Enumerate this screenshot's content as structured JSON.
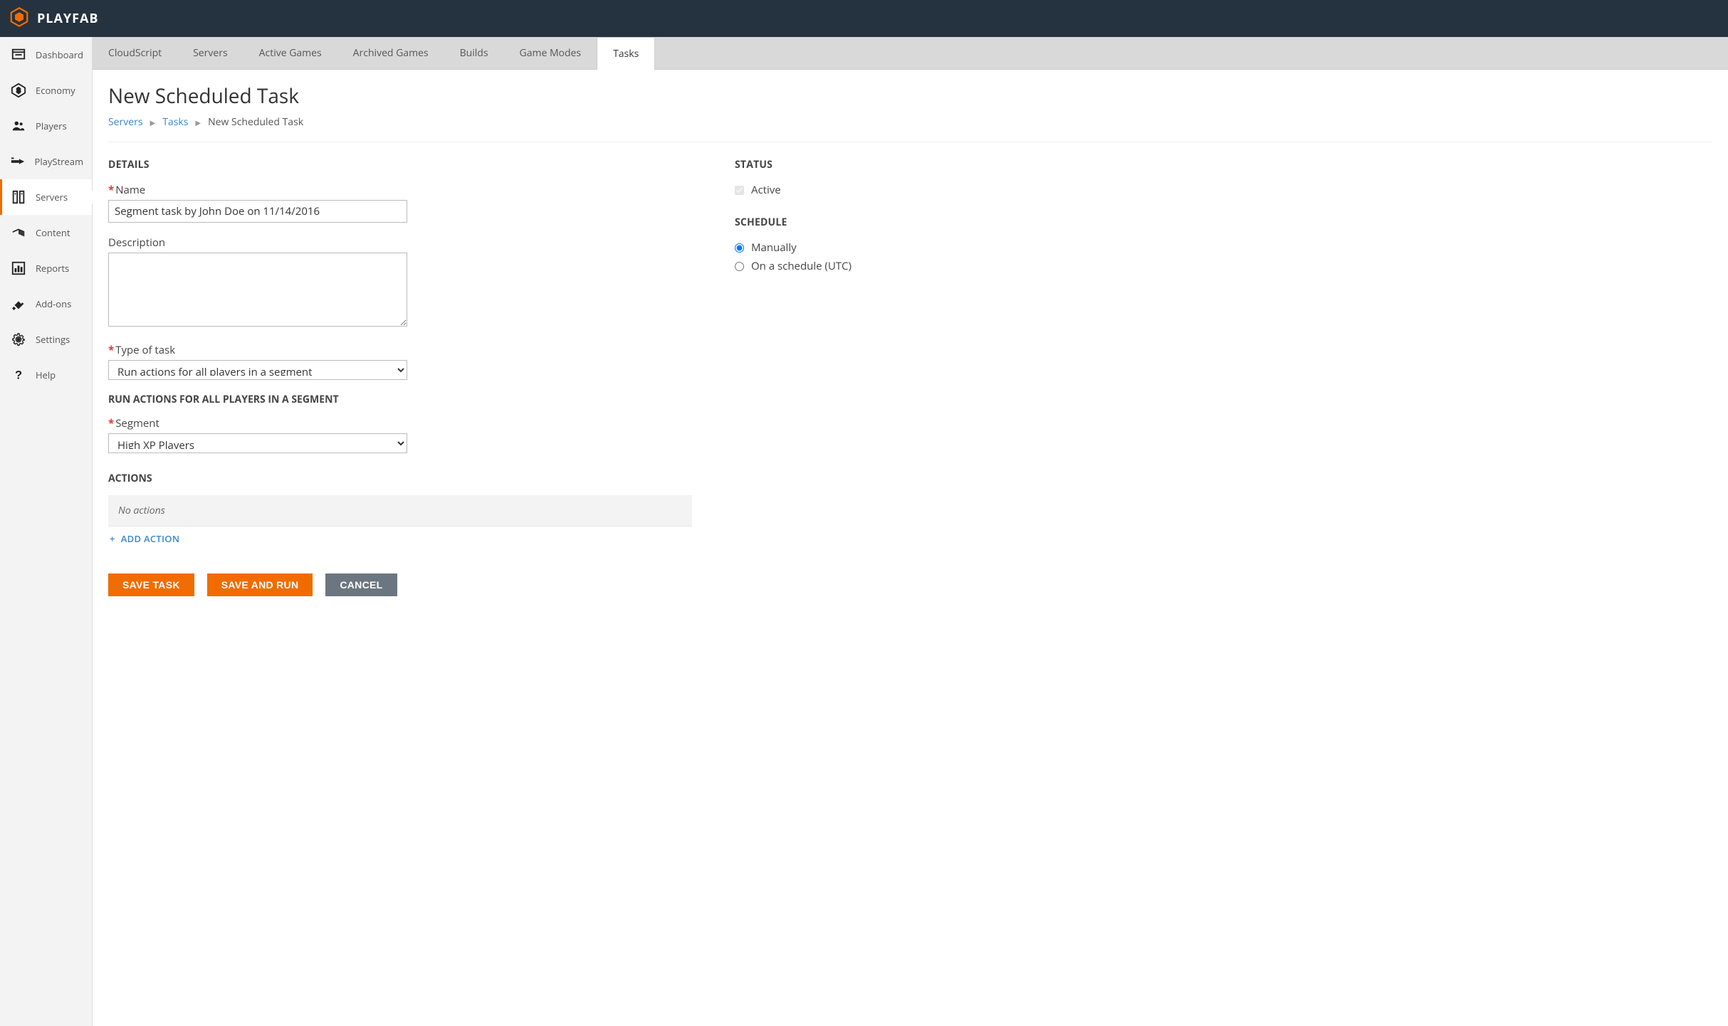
{
  "brand": {
    "name": "PLAYFAB"
  },
  "sidebar": {
    "items": [
      {
        "label": "Dashboard"
      },
      {
        "label": "Economy"
      },
      {
        "label": "Players"
      },
      {
        "label": "PlayStream"
      },
      {
        "label": "Servers"
      },
      {
        "label": "Content"
      },
      {
        "label": "Reports"
      },
      {
        "label": "Add-ons"
      },
      {
        "label": "Settings"
      },
      {
        "label": "Help"
      }
    ],
    "active_index": 4
  },
  "tabs": {
    "items": [
      {
        "label": "CloudScript"
      },
      {
        "label": "Servers"
      },
      {
        "label": "Active Games"
      },
      {
        "label": "Archived Games"
      },
      {
        "label": "Builds"
      },
      {
        "label": "Game Modes"
      },
      {
        "label": "Tasks"
      }
    ],
    "active_index": 6
  },
  "page": {
    "title": "New Scheduled Task",
    "breadcrumb": {
      "a": "Servers",
      "b": "Tasks",
      "current": "New Scheduled Task"
    }
  },
  "details": {
    "heading": "DETAILS",
    "name_label": "Name",
    "name_value": "Segment task by John Doe on 11/14/2016",
    "desc_label": "Description",
    "desc_value": "",
    "type_label": "Type of task",
    "type_value": "Run actions for all players in a segment",
    "subsection": "RUN ACTIONS FOR ALL PLAYERS IN A SEGMENT",
    "segment_label": "Segment",
    "segment_value": "High XP Players"
  },
  "actions": {
    "heading": "ACTIONS",
    "empty": "No actions",
    "add_label": "ADD ACTION"
  },
  "buttons": {
    "save": "SAVE TASK",
    "save_run": "SAVE AND RUN",
    "cancel": "CANCEL"
  },
  "status": {
    "heading": "STATUS",
    "active_label": "Active",
    "active_checked": true
  },
  "schedule": {
    "heading": "SCHEDULE",
    "options": [
      {
        "label": "Manually",
        "checked": true
      },
      {
        "label": "On a schedule (UTC)",
        "checked": false
      }
    ]
  }
}
